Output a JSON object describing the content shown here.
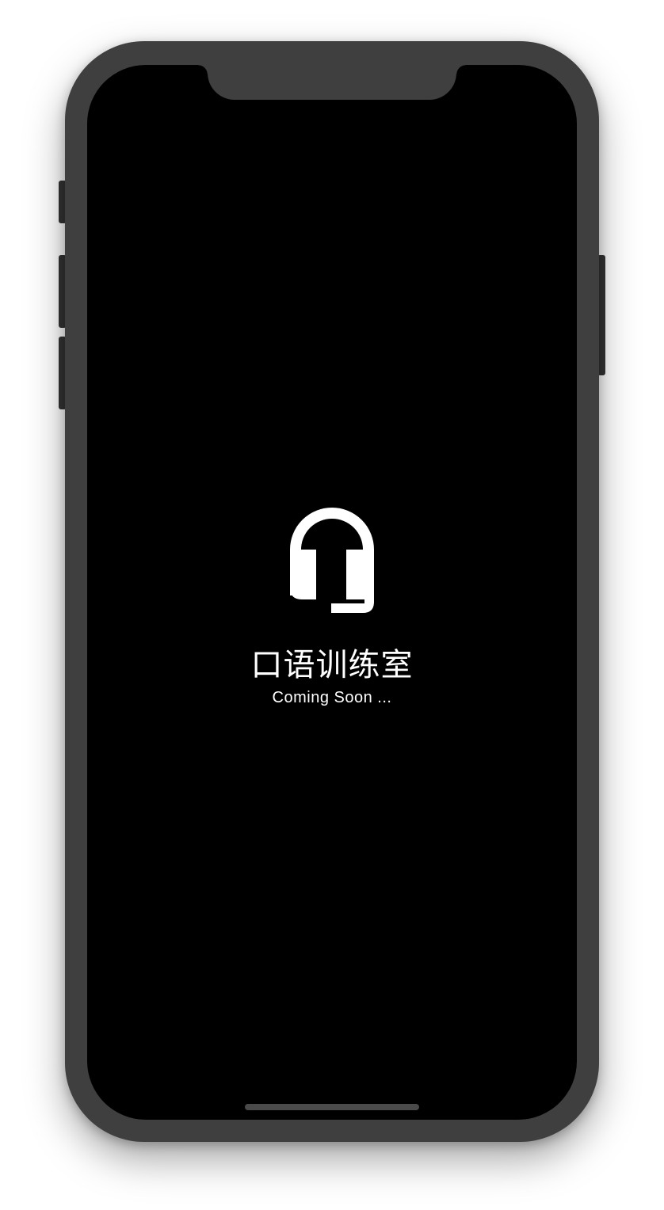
{
  "app": {
    "title": "口语训练室",
    "subtitle": "Coming Soon ...",
    "icon": "headset-icon"
  },
  "colors": {
    "background": "#000000",
    "frame": "#3f3f3f",
    "text": "#ffffff",
    "home_indicator": "#4a4a4a"
  }
}
